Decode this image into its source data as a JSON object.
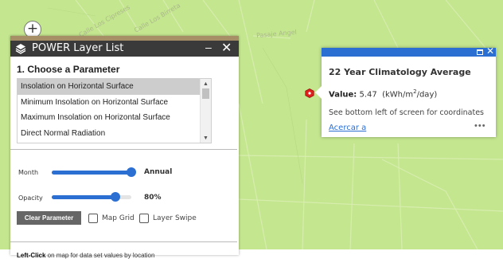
{
  "map": {
    "street_labels": [
      "Calle Los Cipreses",
      "Calle Los Birreta",
      "Pasaje Angel"
    ],
    "zoom_in_label": "+"
  },
  "layer_panel": {
    "title": "POWER Layer List",
    "minimize_label": "–",
    "close_label": "✕",
    "section_title": "1. Choose a Parameter",
    "parameters": [
      "Insolation on Horizontal Surface",
      "Minimum Insolation on Horizontal Surface",
      "Maximum Insolation on Horizontal Surface",
      "Direct Normal Radiation"
    ],
    "selected_parameter": "Insolation on Horizontal Surface",
    "month": {
      "label": "Month",
      "value_label": "Annual",
      "level": 1.0
    },
    "opacity": {
      "label": "Opacity",
      "value_label": "80%",
      "level": 0.8
    },
    "clear_button_label": "Clear Parameter",
    "map_grid_label": "Map Grid",
    "layer_swipe_label": "Layer Swipe",
    "footer_bold": "Left-Click",
    "footer_rest": " on map for data set values by location"
  },
  "popup": {
    "title": "22 Year Climatology Average",
    "value_label": "Value:",
    "value": "5.47",
    "unit_prefix": "(kWh/m",
    "unit_sup": "2",
    "unit_suffix": "/day)",
    "note": "See bottom left of screen for coordinates",
    "link_label": "Acercar a",
    "more_label": "•••"
  },
  "colors": {
    "map_background": "#c4e68f",
    "panel_header": "#3a3a3a",
    "panel_accent": "#a68f67",
    "slider_blue": "#2b6fd3",
    "popup_header": "#2b6fd3",
    "marker_red": "#e0201c"
  },
  "icons": [
    "zoom-in-icon",
    "layers-icon",
    "minimize-icon",
    "close-icon",
    "scroll-up-icon",
    "scroll-down-icon",
    "location-marker-icon",
    "maximize-icon",
    "popup-close-icon",
    "more-options-icon"
  ]
}
